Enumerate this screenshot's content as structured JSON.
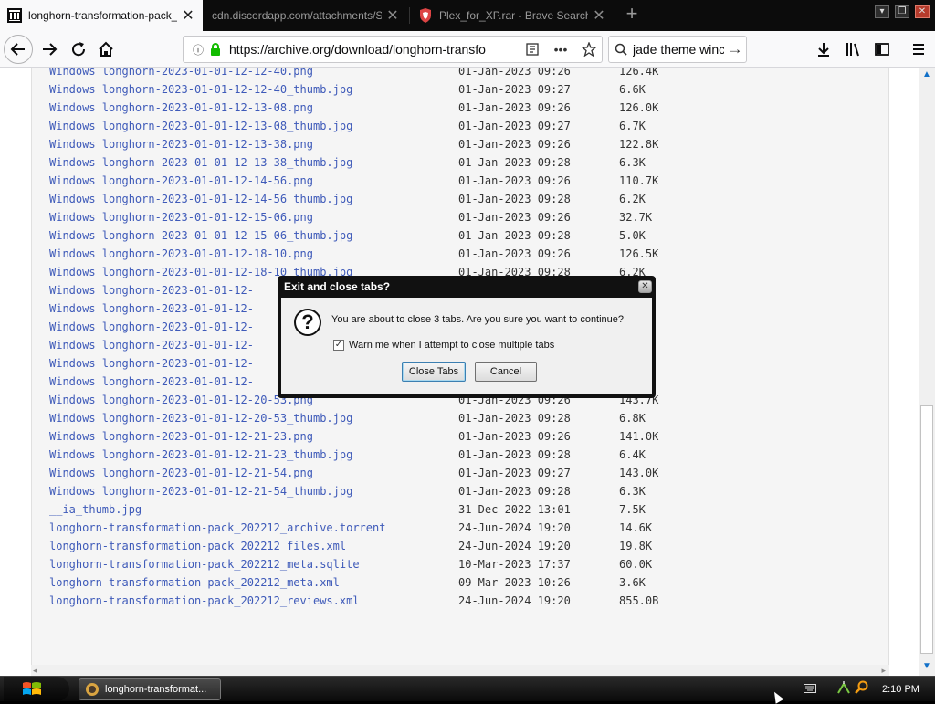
{
  "tabs": [
    {
      "label": "longhorn-transformation-pack_",
      "active": true
    },
    {
      "label": "cdn.discordapp.com/attachments/S",
      "active": false
    },
    {
      "label": "Plex_for_XP.rar - Brave Search",
      "active": false
    }
  ],
  "new_tab_label": "+",
  "window_controls": {
    "minimize": "▾",
    "restore": "❐",
    "close": "✕"
  },
  "nav": {
    "url": "https://archive.org/download/longhorn-transfo",
    "search_text": "jade theme winc",
    "info_glyph": "ⓘ",
    "more_glyph": "•••",
    "go_glyph": "→"
  },
  "files": [
    {
      "name": "Windows longhorn-2023-01-01-12-12-40.png",
      "date": "01-Jan-2023 09:26",
      "size": "126.4K"
    },
    {
      "name": "Windows longhorn-2023-01-01-12-12-40_thumb.jpg",
      "date": "01-Jan-2023 09:27",
      "size": "6.6K"
    },
    {
      "name": "Windows longhorn-2023-01-01-12-13-08.png",
      "date": "01-Jan-2023 09:26",
      "size": "126.0K"
    },
    {
      "name": "Windows longhorn-2023-01-01-12-13-08_thumb.jpg",
      "date": "01-Jan-2023 09:27",
      "size": "6.7K"
    },
    {
      "name": "Windows longhorn-2023-01-01-12-13-38.png",
      "date": "01-Jan-2023 09:26",
      "size": "122.8K"
    },
    {
      "name": "Windows longhorn-2023-01-01-12-13-38_thumb.jpg",
      "date": "01-Jan-2023 09:28",
      "size": "6.3K"
    },
    {
      "name": "Windows longhorn-2023-01-01-12-14-56.png",
      "date": "01-Jan-2023 09:26",
      "size": "110.7K"
    },
    {
      "name": "Windows longhorn-2023-01-01-12-14-56_thumb.jpg",
      "date": "01-Jan-2023 09:28",
      "size": "6.2K"
    },
    {
      "name": "Windows longhorn-2023-01-01-12-15-06.png",
      "date": "01-Jan-2023 09:26",
      "size": "32.7K"
    },
    {
      "name": "Windows longhorn-2023-01-01-12-15-06_thumb.jpg",
      "date": "01-Jan-2023 09:28",
      "size": "5.0K"
    },
    {
      "name": "Windows longhorn-2023-01-01-12-18-10.png",
      "date": "01-Jan-2023 09:26",
      "size": "126.5K"
    },
    {
      "name": "Windows longhorn-2023-01-01-12-18-10_thumb.jpg",
      "date": "01-Jan-2023 09:28",
      "size": "6.2K"
    },
    {
      "name": "Windows longhorn-2023-01-01-12-",
      "date": "",
      "size": "K"
    },
    {
      "name": "Windows longhorn-2023-01-01-12-",
      "date": "",
      "size": ""
    },
    {
      "name": "Windows longhorn-2023-01-01-12-",
      "date": "",
      "size": "K"
    },
    {
      "name": "Windows longhorn-2023-01-01-12-",
      "date": "",
      "size": ""
    },
    {
      "name": "Windows longhorn-2023-01-01-12-",
      "date": "",
      "size": "K"
    },
    {
      "name": "Windows longhorn-2023-01-01-12-",
      "date": "",
      "size": ""
    },
    {
      "name": "Windows longhorn-2023-01-01-12-20-53.png",
      "date": "01-Jan-2023 09:26",
      "size": "143.7K"
    },
    {
      "name": "Windows longhorn-2023-01-01-12-20-53_thumb.jpg",
      "date": "01-Jan-2023 09:28",
      "size": "6.8K"
    },
    {
      "name": "Windows longhorn-2023-01-01-12-21-23.png",
      "date": "01-Jan-2023 09:26",
      "size": "141.0K"
    },
    {
      "name": "Windows longhorn-2023-01-01-12-21-23_thumb.jpg",
      "date": "01-Jan-2023 09:28",
      "size": "6.4K"
    },
    {
      "name": "Windows longhorn-2023-01-01-12-21-54.png",
      "date": "01-Jan-2023 09:27",
      "size": "143.0K"
    },
    {
      "name": "Windows longhorn-2023-01-01-12-21-54_thumb.jpg",
      "date": "01-Jan-2023 09:28",
      "size": "6.3K"
    },
    {
      "name": "__ia_thumb.jpg",
      "date": "31-Dec-2022 13:01",
      "size": "7.5K"
    },
    {
      "name": "longhorn-transformation-pack_202212_archive.torrent",
      "date": "24-Jun-2024 19:20",
      "size": "14.6K"
    },
    {
      "name": "longhorn-transformation-pack_202212_files.xml",
      "date": "24-Jun-2024 19:20",
      "size": "19.8K"
    },
    {
      "name": "longhorn-transformation-pack_202212_meta.sqlite",
      "date": "10-Mar-2023 17:37",
      "size": "60.0K"
    },
    {
      "name": "longhorn-transformation-pack_202212_meta.xml",
      "date": "09-Mar-2023 10:26",
      "size": "3.6K"
    },
    {
      "name": "longhorn-transformation-pack_202212_reviews.xml",
      "date": "24-Jun-2024 19:20",
      "size": "855.0B"
    }
  ],
  "dialog": {
    "title": "Exit and close tabs?",
    "message": "You are about to close 3 tabs. Are you sure you want to continue?",
    "checkbox_label": "Warn me when I attempt to close multiple tabs",
    "checkbox_checked": true,
    "close_tabs_label": "Close Tabs",
    "cancel_label": "Cancel"
  },
  "taskbar": {
    "item_label": "longhorn-transformat...",
    "clock": "2:10 PM"
  }
}
